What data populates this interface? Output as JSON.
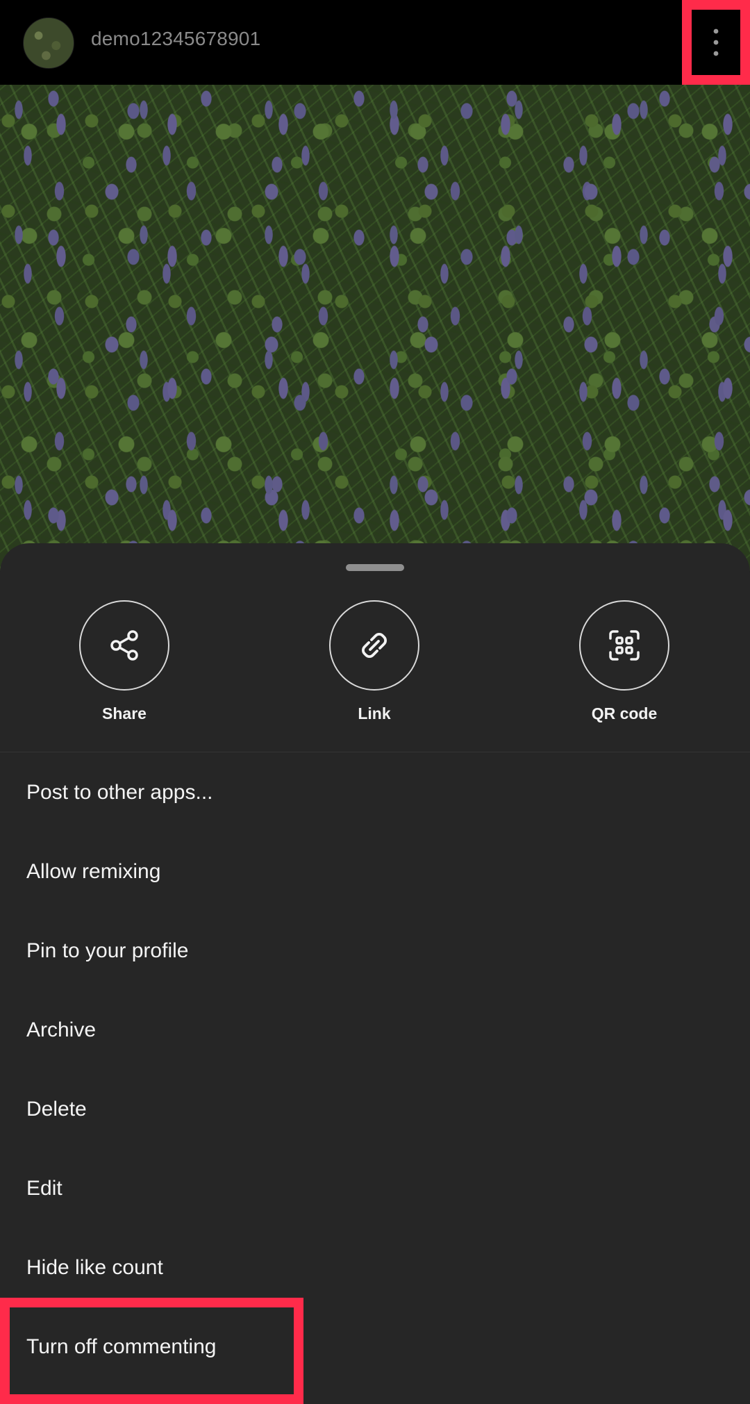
{
  "header": {
    "username": "demo12345678901"
  },
  "quick_actions": [
    {
      "label": "Share",
      "icon": "share-icon"
    },
    {
      "label": "Link",
      "icon": "link-icon"
    },
    {
      "label": "QR code",
      "icon": "qr-code-icon"
    }
  ],
  "menu": {
    "items": [
      {
        "label": "Post to other apps..."
      },
      {
        "label": "Allow remixing"
      },
      {
        "label": "Pin to your profile"
      },
      {
        "label": "Archive"
      },
      {
        "label": "Delete"
      },
      {
        "label": "Edit"
      },
      {
        "label": "Hide like count"
      },
      {
        "label": "Turn off commenting"
      }
    ]
  },
  "colors": {
    "highlight": "#ff2b4a",
    "sheet_background": "#262626"
  }
}
